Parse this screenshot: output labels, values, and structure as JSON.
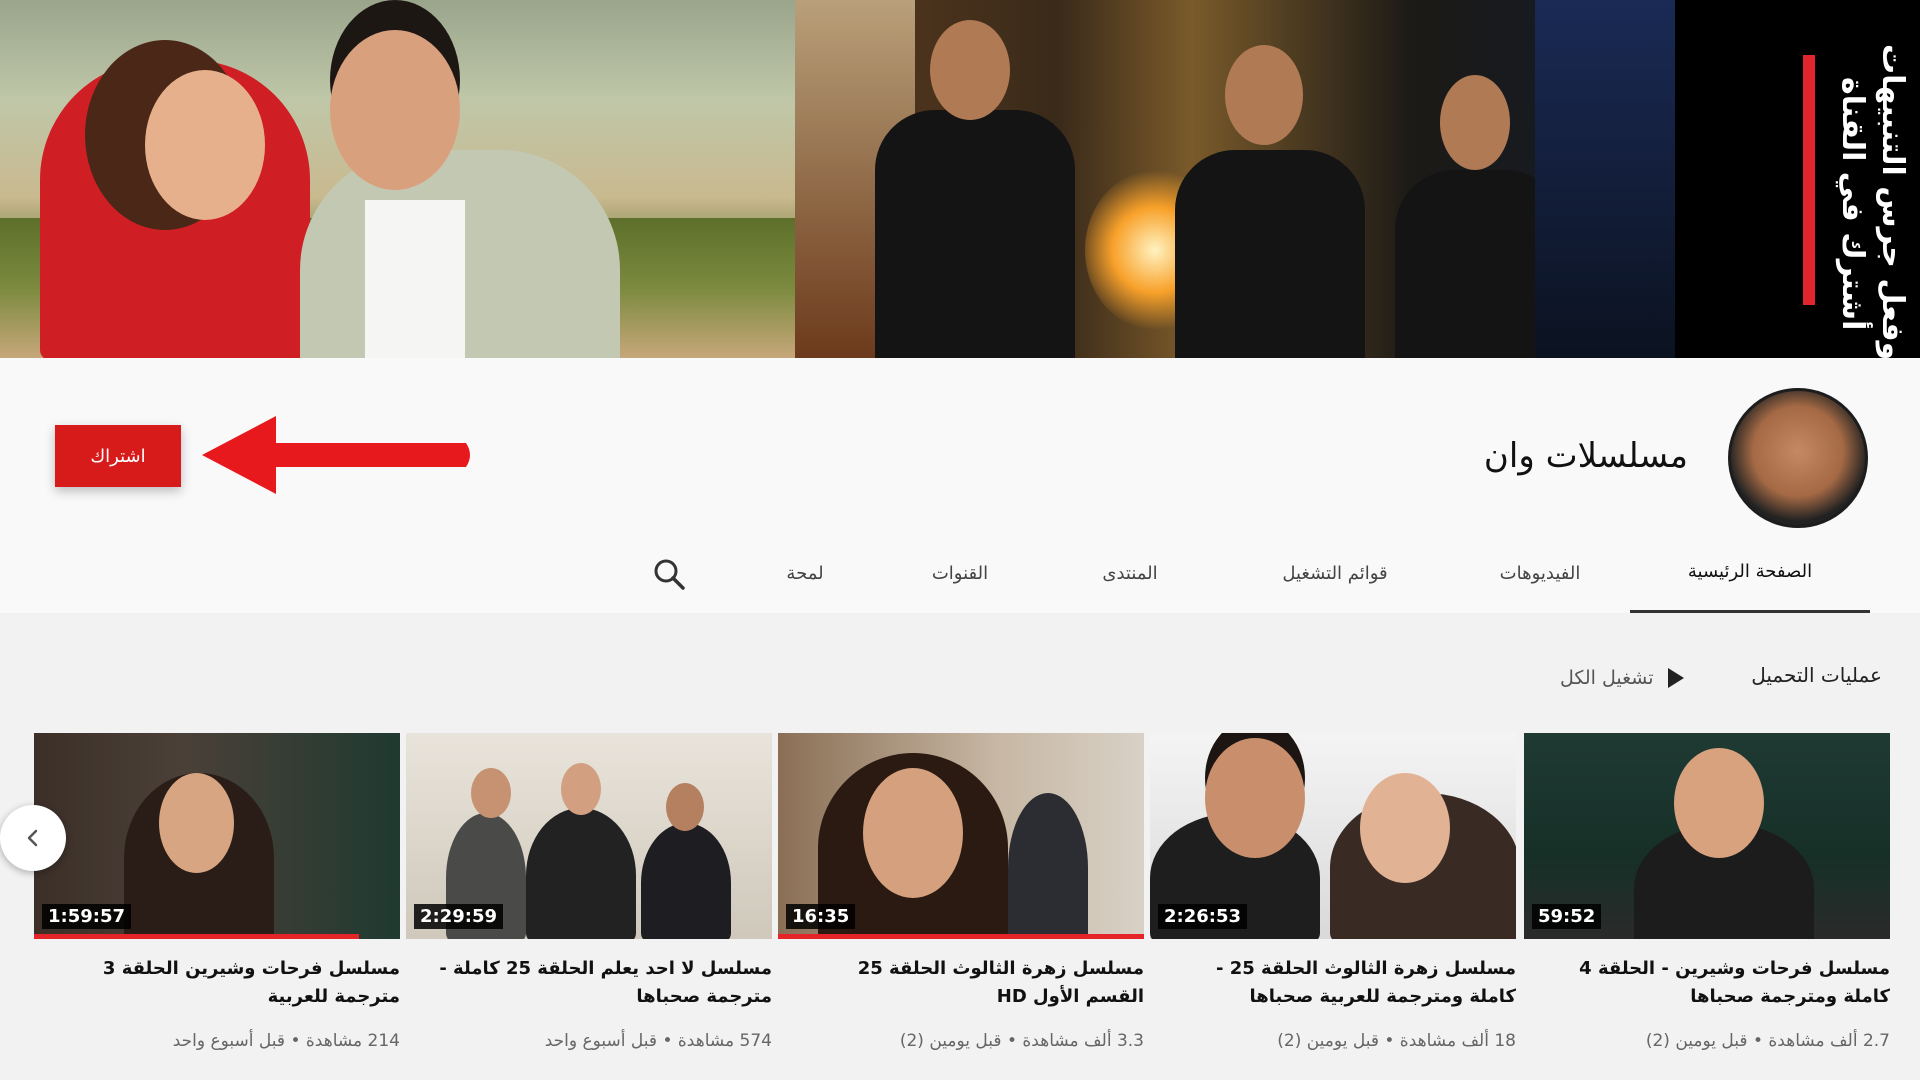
{
  "banner": {
    "cta_line1": "أشترك في القناة",
    "cta_line2": "وفعل جرس التنبيهات"
  },
  "channel": {
    "name": "مسلسلات وان",
    "subscribe_label": "اشتراك"
  },
  "tabs": [
    {
      "label": "الصفحة الرئيسية",
      "active": true
    },
    {
      "label": "الفيديوهات",
      "active": false
    },
    {
      "label": "قوائم التشغيل",
      "active": false
    },
    {
      "label": "المنتدى",
      "active": false
    },
    {
      "label": "القنوات",
      "active": false
    },
    {
      "label": "لمحة",
      "active": false
    }
  ],
  "section": {
    "title": "عمليات التحميل",
    "play_all_label": "تشغيل الكل"
  },
  "videos": [
    {
      "duration": "59:52",
      "title": "مسلسل فرحات وشيرين - الحلقة 4 كاملة ومترجمة صحباها",
      "meta": "2.7 ألف مشاهدة • قبل يومين (2)"
    },
    {
      "duration": "2:26:53",
      "title": "مسلسل زهرة الثالوث الحلقة 25 - كاملة ومترجمة للعربية صحباها",
      "meta": "18 ألف مشاهدة • قبل يومين (2)"
    },
    {
      "duration": "16:35",
      "title": "مسلسل زهرة الثالوث الحلقة 25 القسم الأول HD",
      "meta": "3.3 ألف مشاهدة • قبل يومين (2)"
    },
    {
      "duration": "2:29:59",
      "title": "مسلسل لا احد يعلم الحلقة 25 كاملة - مترجمة صحباها",
      "meta": "574 مشاهدة • قبل أسبوع واحد"
    },
    {
      "duration": "1:59:57",
      "title": "مسلسل فرحات وشيرين الحلقة 3 مترجمة للعربية",
      "meta": "214 مشاهدة • قبل أسبوع واحد"
    }
  ],
  "colors": {
    "accent_red": "#d71a1a",
    "progress_red": "#e5242a"
  },
  "icons": {
    "search": "search-icon",
    "play": "play-icon",
    "prev": "chevron-left-icon",
    "arrow": "arrow-left-icon"
  }
}
